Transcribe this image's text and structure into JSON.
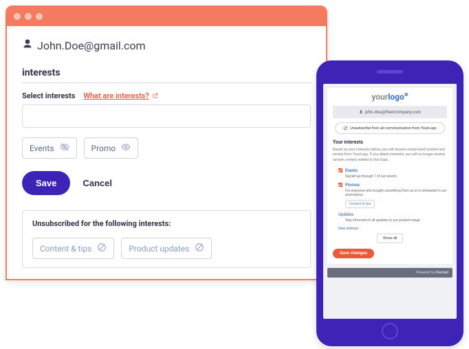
{
  "desktop": {
    "email": "John.Doe@gmail.com",
    "section_title": "interests",
    "select_label": "Select interests",
    "help_link": "What are interests?",
    "input_value": "",
    "chips": {
      "events": "Events",
      "promo": "Promo"
    },
    "save": "Save",
    "cancel": "Cancel",
    "unsub_title": "Unsubscribed for the following interests:",
    "unsub_chips": {
      "content_tips": "Content & tips",
      "product_updates": "Product updates"
    }
  },
  "mobile": {
    "logo_your": "your",
    "logo_logo": "logo",
    "email": "john.doe@theircompany.com",
    "unsub_pill": "Unsubscribe from all communication from YourLogo",
    "interests_title": "Your interests",
    "interests_desc": "Based on your interests below, you will receive customized content and emails from YourLogo. If you delete interests, you will no longer receive certain content related to this topic.",
    "events_title": "Events",
    "events_sub": "Signed up through 1 of our events",
    "promos_title": "Promos",
    "promos_sub": "For everyone who bought something from us or is interested in our promotions.",
    "content_tag": "Content & tips",
    "updates_title": "Updates",
    "updates_sub": "Stay informed of all updates to our product range",
    "new_interest": "New interest",
    "show_all": "Show all",
    "save": "Save changes",
    "powered": "Powered by",
    "brand": "Flexmail"
  }
}
